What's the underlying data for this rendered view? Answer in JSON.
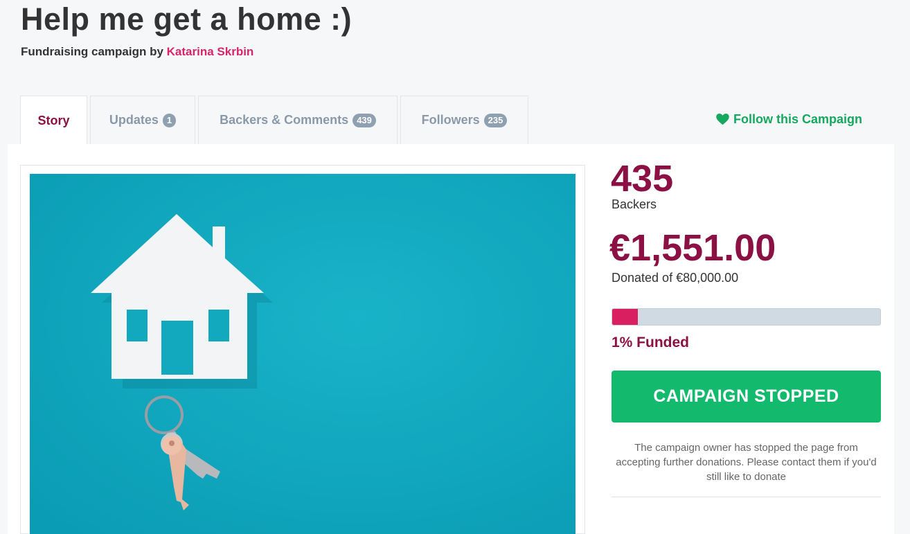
{
  "campaign": {
    "title": "Help me get a home :)",
    "subtitle_prefix": "Fundraising campaign by",
    "owner_name": "Katarina Skrbin"
  },
  "tabs": [
    {
      "label": "Story",
      "badge": null,
      "active": true
    },
    {
      "label": "Updates",
      "badge": "1",
      "active": false
    },
    {
      "label": "Backers & Comments",
      "badge": "439",
      "active": false
    },
    {
      "label": "Followers",
      "badge": "235",
      "active": false
    }
  ],
  "follow": {
    "label": "Follow this Campaign",
    "icon": "heart-icon"
  },
  "stats": {
    "backers_count": "435",
    "backers_label": "Backers",
    "amount_raised": "€1,551.00",
    "donated_of": "Donated of €80,000.00",
    "funded_percent": 1,
    "funded_label": "1% Funded"
  },
  "status": {
    "button_label": "CAMPAIGN STOPPED",
    "note": "The campaign owner has stopped the page from accepting further donations. Please contact them if you'd still like to donate"
  },
  "colors": {
    "accent": "#8b1043",
    "owner_link": "#d6256b",
    "success": "#13b96d",
    "progress_fill": "#d91f5f",
    "image_bg": "#10a6bd"
  }
}
